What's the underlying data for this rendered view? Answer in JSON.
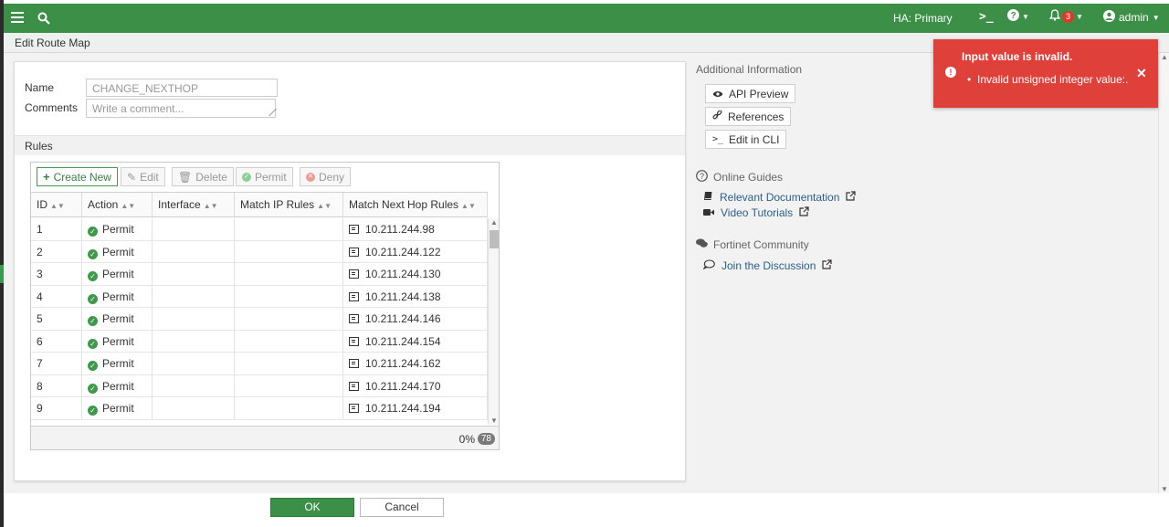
{
  "topbar": {
    "ha_label": "HA: Primary",
    "notification_count": "3",
    "user": "admin",
    "accent": "#3b8f47"
  },
  "header": {
    "title": "Edit Route Map"
  },
  "form": {
    "name_label": "Name",
    "name_value": "CHANGE_NEXTHOP",
    "comments_label": "Comments",
    "comments_placeholder": "Write a comment..."
  },
  "rules": {
    "section_label": "Rules",
    "toolbar": {
      "create_new": "Create New",
      "edit": "Edit",
      "delete": "Delete",
      "permit": "Permit",
      "deny": "Deny"
    },
    "columns": [
      "ID",
      "Action",
      "Interface",
      "Match IP Rules",
      "Match Next Hop Rules"
    ],
    "rows": [
      {
        "id": "1",
        "action": "Permit",
        "interface": "",
        "match_ip": "",
        "next_hop": "10.211.244.98"
      },
      {
        "id": "2",
        "action": "Permit",
        "interface": "",
        "match_ip": "",
        "next_hop": "10.211.244.122"
      },
      {
        "id": "3",
        "action": "Permit",
        "interface": "",
        "match_ip": "",
        "next_hop": "10.211.244.130"
      },
      {
        "id": "4",
        "action": "Permit",
        "interface": "",
        "match_ip": "",
        "next_hop": "10.211.244.138"
      },
      {
        "id": "5",
        "action": "Permit",
        "interface": "",
        "match_ip": "",
        "next_hop": "10.211.244.146"
      },
      {
        "id": "6",
        "action": "Permit",
        "interface": "",
        "match_ip": "",
        "next_hop": "10.211.244.154"
      },
      {
        "id": "7",
        "action": "Permit",
        "interface": "",
        "match_ip": "",
        "next_hop": "10.211.244.162"
      },
      {
        "id": "8",
        "action": "Permit",
        "interface": "",
        "match_ip": "",
        "next_hop": "10.211.244.170"
      },
      {
        "id": "9",
        "action": "Permit",
        "interface": "",
        "match_ip": "",
        "next_hop": "10.211.244.194"
      }
    ],
    "footer": {
      "percent": "0%",
      "total": "78"
    }
  },
  "side": {
    "additional_title": "Additional Information",
    "api_preview": "API Preview",
    "references": "References",
    "edit_in_cli": "Edit in CLI",
    "online_guides_title": "Online Guides",
    "relevant_docs": "Relevant Documentation",
    "video_tutorials": "Video Tutorials",
    "community_title": "Fortinet Community",
    "join_discussion": "Join the Discussion"
  },
  "toast": {
    "title": "Input value is invalid.",
    "message": "Invalid unsigned integer value:.",
    "color": "#e0403a"
  },
  "buttons": {
    "ok": "OK",
    "cancel": "Cancel"
  }
}
